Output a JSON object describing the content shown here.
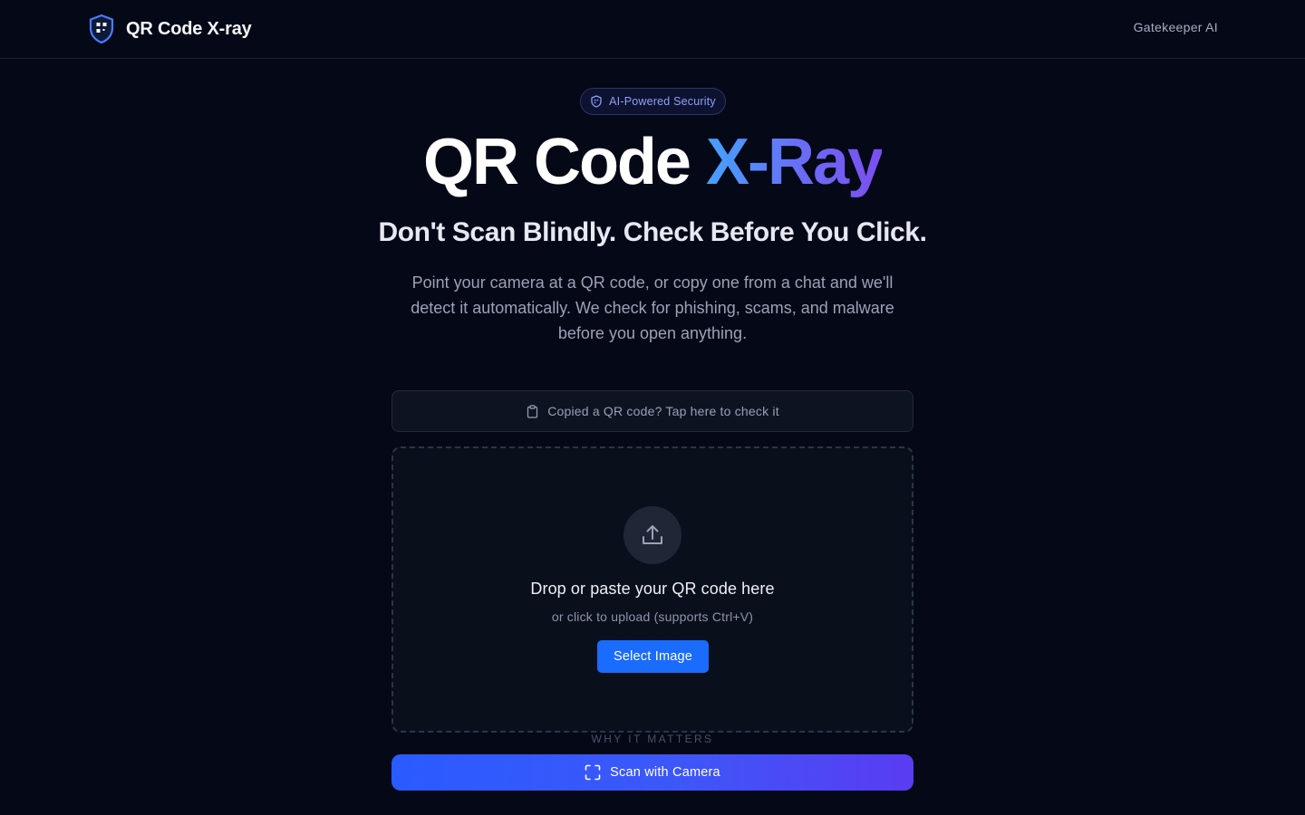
{
  "header": {
    "brand_title": "QR Code X-ray",
    "nav_link": "Gatekeeper AI"
  },
  "hero": {
    "badge": "AI-Powered Security",
    "title_main": "QR Code ",
    "title_accent": "X-Ray",
    "subtitle": "Don't Scan Blindly. Check Before You Click.",
    "description": "Point your camera at a QR code, or copy one from a chat and we'll detect it automatically. We check for phishing, scams, and malware before you open anything."
  },
  "clipboard": {
    "label": "Copied a QR code? Tap here to check it",
    "icon": "clipboard-icon"
  },
  "dropzone": {
    "icon": "upload-icon",
    "title": "Drop or paste your QR code here",
    "hint": "or click to upload (supports Ctrl+V)",
    "button_label": "Select Image"
  },
  "section_label": "WHY IT MATTERS",
  "camera": {
    "label": "Scan with Camera",
    "icon": "scan-frame-icon"
  },
  "colors": {
    "background": "#050816",
    "primary_button": "#1a6bff",
    "accent_gradient_start": "#45a2ff",
    "accent_gradient_end": "#7c4ef0",
    "badge_text": "#8ea0f5"
  }
}
